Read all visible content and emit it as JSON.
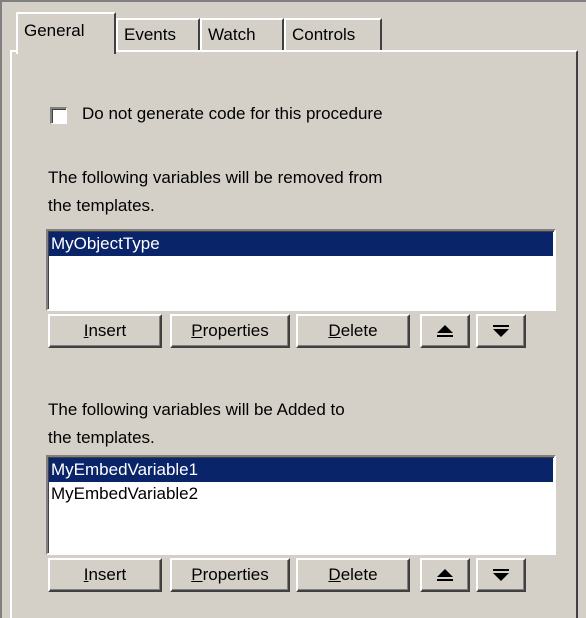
{
  "tabs": [
    {
      "label": "General"
    },
    {
      "label": "Events"
    },
    {
      "label": "Watch"
    },
    {
      "label": "Controls"
    }
  ],
  "checkbox": {
    "label": "Do not generate code for this procedure",
    "checked": false
  },
  "removed_section": {
    "line1": "The following variables will be removed from",
    "line2": "the templates.",
    "items": [
      "MyObjectType"
    ],
    "selected_index": 0
  },
  "added_section": {
    "line1": "The following variables will be Added to",
    "line2": "the templates.",
    "items": [
      "MyEmbedVariable1",
      "MyEmbedVariable2"
    ],
    "selected_index": 0
  },
  "buttons": {
    "insert_mnemonic": "I",
    "insert_rest": "nsert",
    "properties_mnemonic": "P",
    "properties_rest": "roperties",
    "delete_mnemonic": "D",
    "delete_rest": "elete"
  },
  "icons": {
    "move_up": "arrow-up-bar-icon",
    "move_down": "arrow-down-bar-icon"
  },
  "colors": {
    "face": "#d4d0c8",
    "selection": "#0a246a"
  }
}
